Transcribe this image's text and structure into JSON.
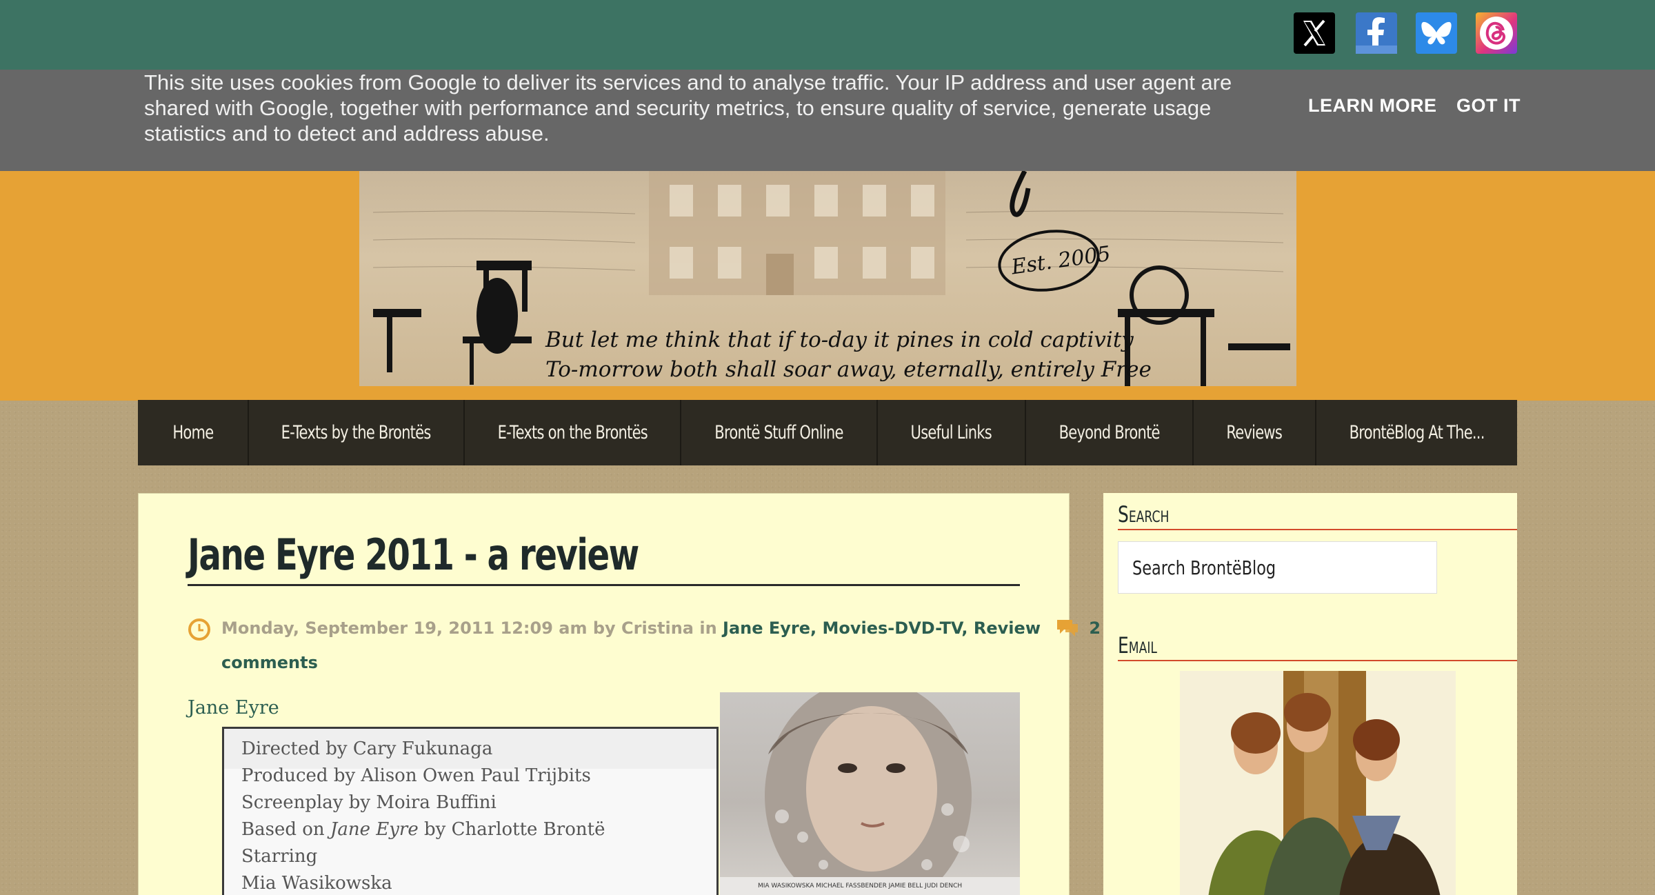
{
  "social": {
    "icons": [
      "x-icon",
      "facebook-icon",
      "bluesky-icon",
      "threads-icon"
    ]
  },
  "cookie": {
    "text": "This site uses cookies from Google to deliver its services and to analyse traffic. Your IP address and user agent are shared with Google, together with performance and security metrics, to ensure quality of service, generate usage statistics and to detect and address abuse.",
    "learn_more": "LEARN MORE",
    "got_it": "GOT IT"
  },
  "header": {
    "est": "Est. 2005",
    "quote_line1": "But let me think that if to-day it pines in cold captivity",
    "quote_line2": "To-morrow both shall soar away, eternally, entirely Free"
  },
  "nav": {
    "items": [
      {
        "label": "Home"
      },
      {
        "label": "E-Texts by the Brontës"
      },
      {
        "label": "E-Texts on the Brontës"
      },
      {
        "label": "Brontë Stuff Online"
      },
      {
        "label": "Useful Links"
      },
      {
        "label": "Beyond Brontë"
      },
      {
        "label": "Reviews"
      },
      {
        "label": "BrontëBlog At The..."
      }
    ]
  },
  "post": {
    "title": "Jane Eyre 2011 - a review",
    "date": "Monday, September 19, 2011 12:09 am",
    "by": "by",
    "author": "Cristina",
    "in": "in",
    "tags": [
      "Jane Eyre",
      "Movies-DVD-TV",
      "Review"
    ],
    "comments_count": "2",
    "comments_label": "comments",
    "infobox_title": "Jane Eyre",
    "infobox_rows": [
      "Directed by Cary Fukunaga",
      "Produced by Alison Owen Paul Trijbits",
      "Screenplay by Moira Buffini",
      "Based on",
      "Starring",
      "Mia Wasikowska"
    ],
    "based_on_title": "Jane Eyre",
    "based_on_author": "by Charlotte Brontë",
    "poster_credits": "MIA WASIKOWSKA   MICHAEL FASSBENDER   JAMIE BELL   JUDI DENCH"
  },
  "sidebar": {
    "search_title": "Search",
    "search_placeholder": "Search BrontëBlog",
    "email_title": "Email"
  },
  "colors": {
    "topbar": "#3d7363",
    "cookie_bg": "#676767",
    "header_bg": "#e6a235",
    "nav_bg": "#2d2a22",
    "post_bg": "#fefdd0",
    "link": "#2c5e50",
    "accent": "#e6a235"
  }
}
